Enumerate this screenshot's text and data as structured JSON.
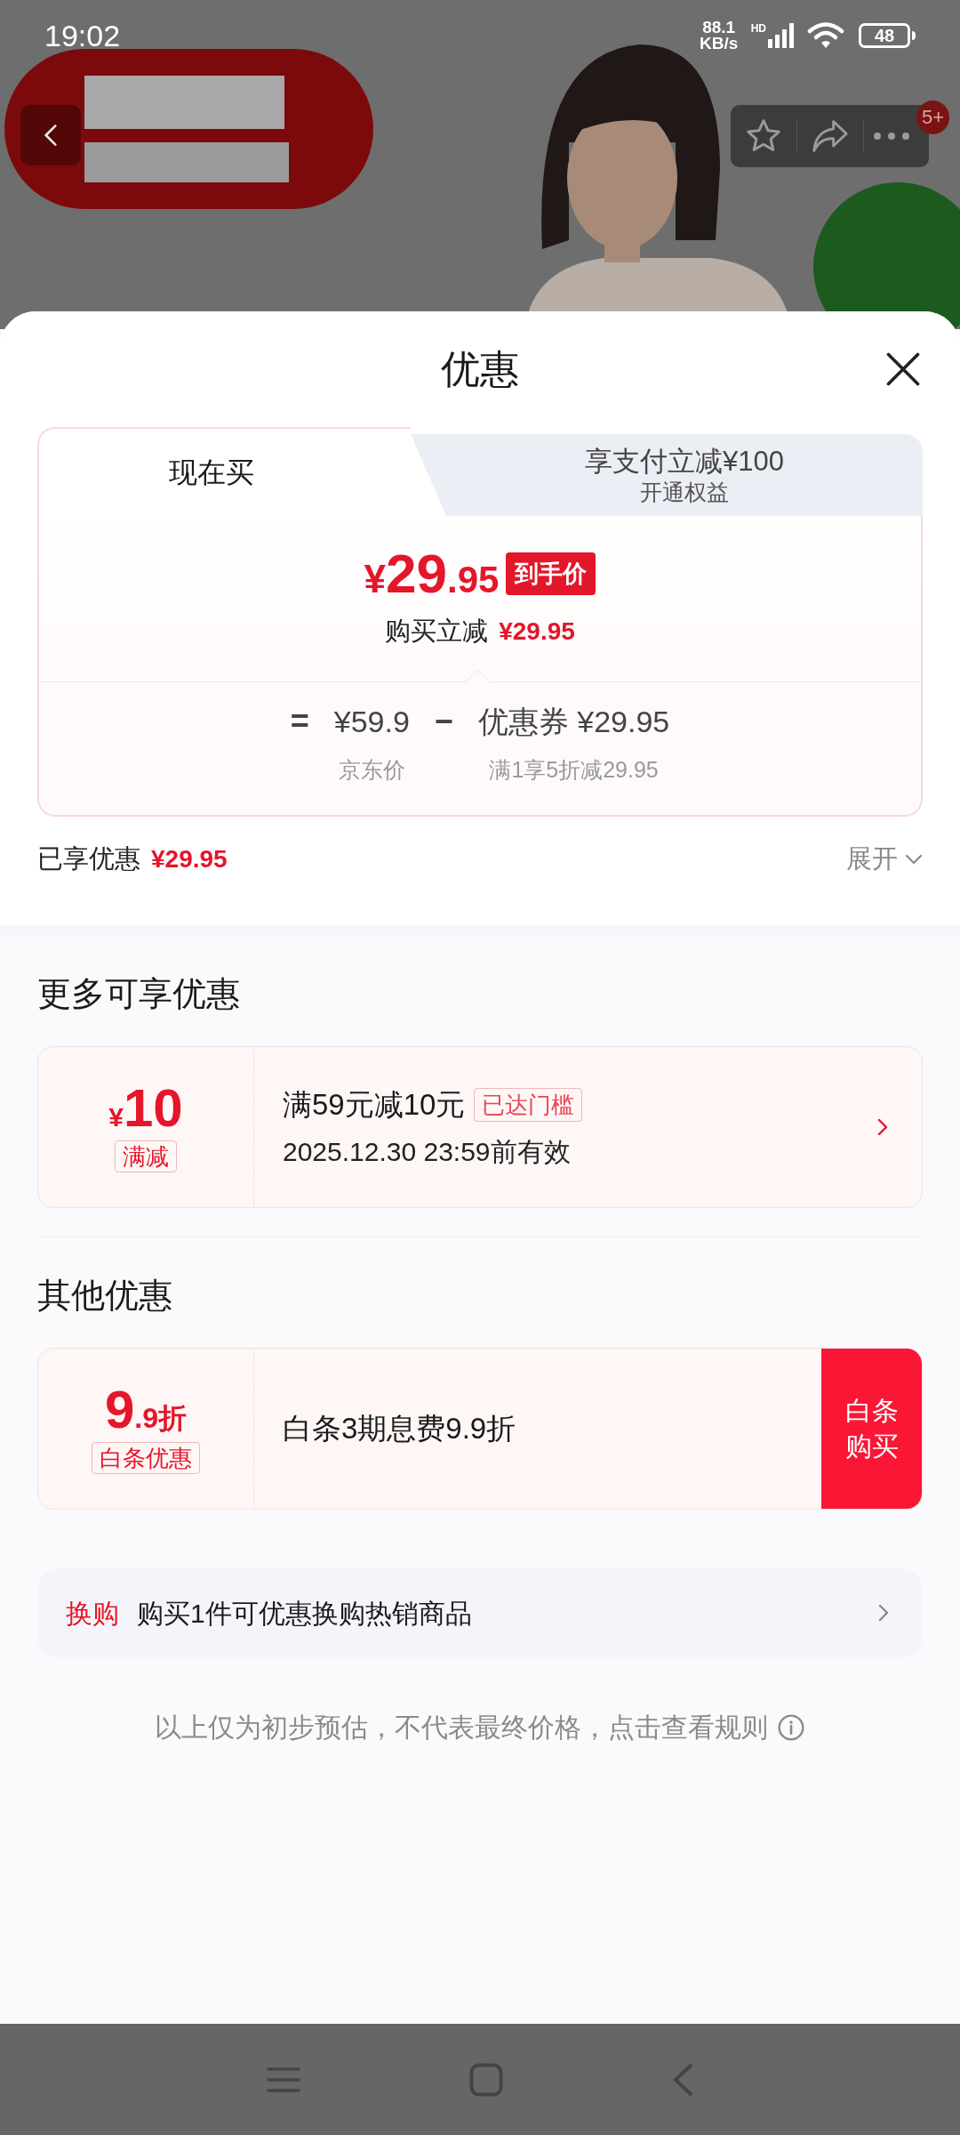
{
  "status_bar": {
    "time": "19:02",
    "speed": "88.1 KB/s",
    "network": "HD",
    "battery": "48"
  },
  "top_actions": {
    "badge": "5+"
  },
  "sheet": {
    "title": "优惠"
  },
  "tabs": [
    {
      "label": "现在买",
      "selected": true
    },
    {
      "label": "享支付立减¥100",
      "sublabel": "开通权益",
      "selected": false
    }
  ],
  "price": {
    "currency": "¥",
    "integer": "29",
    "decimal": ".95",
    "tag": "到手价",
    "note": "购买立减",
    "note_amount": "¥29.95"
  },
  "breakdown": {
    "equals": "=",
    "minus": "−",
    "terms": [
      {
        "value": "¥59.9",
        "label": "京东价"
      },
      {
        "value": "优惠券 ¥29.95",
        "label": "满1享5折减29.95"
      }
    ]
  },
  "enjoyed": {
    "label": "已享优惠",
    "amount": "¥29.95",
    "toggle": "展开"
  },
  "sections": [
    {
      "title": "更多可享优惠",
      "offers": [
        {
          "kind": "coupon",
          "symbol": "¥",
          "amount": "10",
          "tag": "满减",
          "title": "满59元减10元",
          "badge": "已达门槛",
          "validity": "2025.12.30 23:59前有效"
        }
      ]
    },
    {
      "title": "其他优惠",
      "offers": [
        {
          "kind": "action",
          "amount": "9",
          "amount_suffix": ".9折",
          "tag": "白条优惠",
          "title": "白条3期息费9.9折",
          "action": "白条购买"
        }
      ]
    }
  ],
  "exchange": {
    "tag": "换购",
    "text": "购买1件可优惠换购热销商品"
  },
  "footer": {
    "text": "以上仅为初步预估，不代表最终价格，点击查看规则"
  }
}
